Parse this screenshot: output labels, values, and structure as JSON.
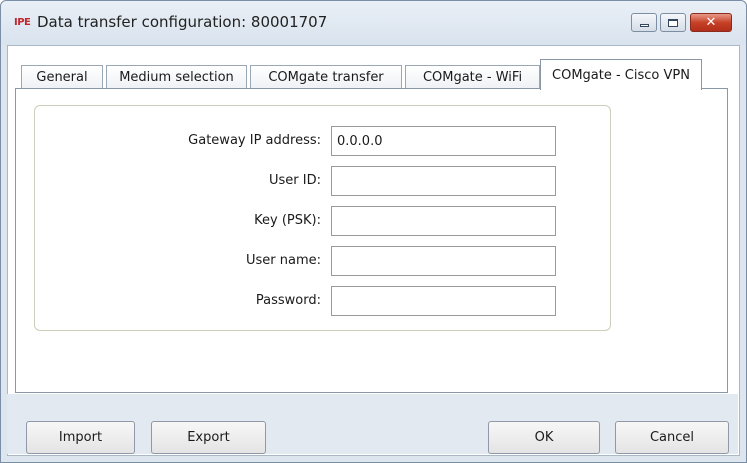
{
  "window": {
    "app_icon_text": "IPE",
    "title": "Data transfer configuration: 80001707"
  },
  "tabs": [
    {
      "label": "General",
      "active": false
    },
    {
      "label": "Medium selection",
      "active": false
    },
    {
      "label": "COMgate transfer",
      "active": false
    },
    {
      "label": "COMgate - WiFi",
      "active": false
    },
    {
      "label": "COMgate - Cisco VPN",
      "active": true
    }
  ],
  "form": {
    "fields": [
      {
        "label": "Gateway IP address:",
        "value": "0.0.0.0"
      },
      {
        "label": "User ID:",
        "value": ""
      },
      {
        "label": "Key (PSK):",
        "value": ""
      },
      {
        "label": "User name:",
        "value": ""
      },
      {
        "label": "Password:",
        "value": ""
      }
    ]
  },
  "buttons": {
    "import": "Import",
    "export": "Export",
    "ok": "OK",
    "cancel": "Cancel"
  },
  "colors": {
    "title_bg": "#dde6ef",
    "close_button": "#c64127",
    "group_border": "#c9cfb8"
  }
}
